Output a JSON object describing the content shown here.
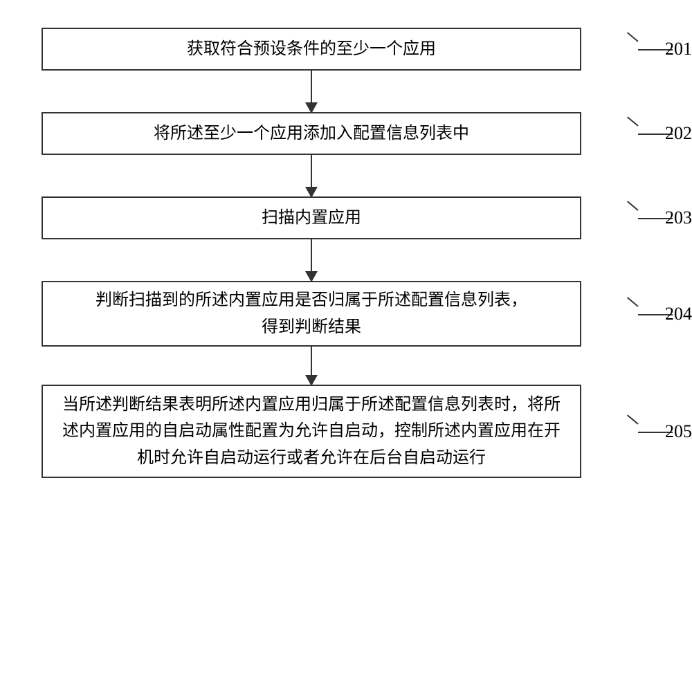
{
  "steps": [
    {
      "text": "获取符合预设条件的至少一个应用",
      "label": "201"
    },
    {
      "text": "将所述至少一个应用添加入配置信息列表中",
      "label": "202"
    },
    {
      "text": "扫描内置应用",
      "label": "203"
    },
    {
      "text": "判断扫描到的所述内置应用是否归属于所述配置信息列表，\n得到判断结果",
      "label": "204"
    },
    {
      "text": "当所述判断结果表明所述内置应用归属于所述配置信息列表时，将所述内置应用的自启动属性配置为允许自启动，控制所述内置应用在开机时允许自启动运行或者允许在后台自启动运行",
      "label": "205"
    }
  ]
}
